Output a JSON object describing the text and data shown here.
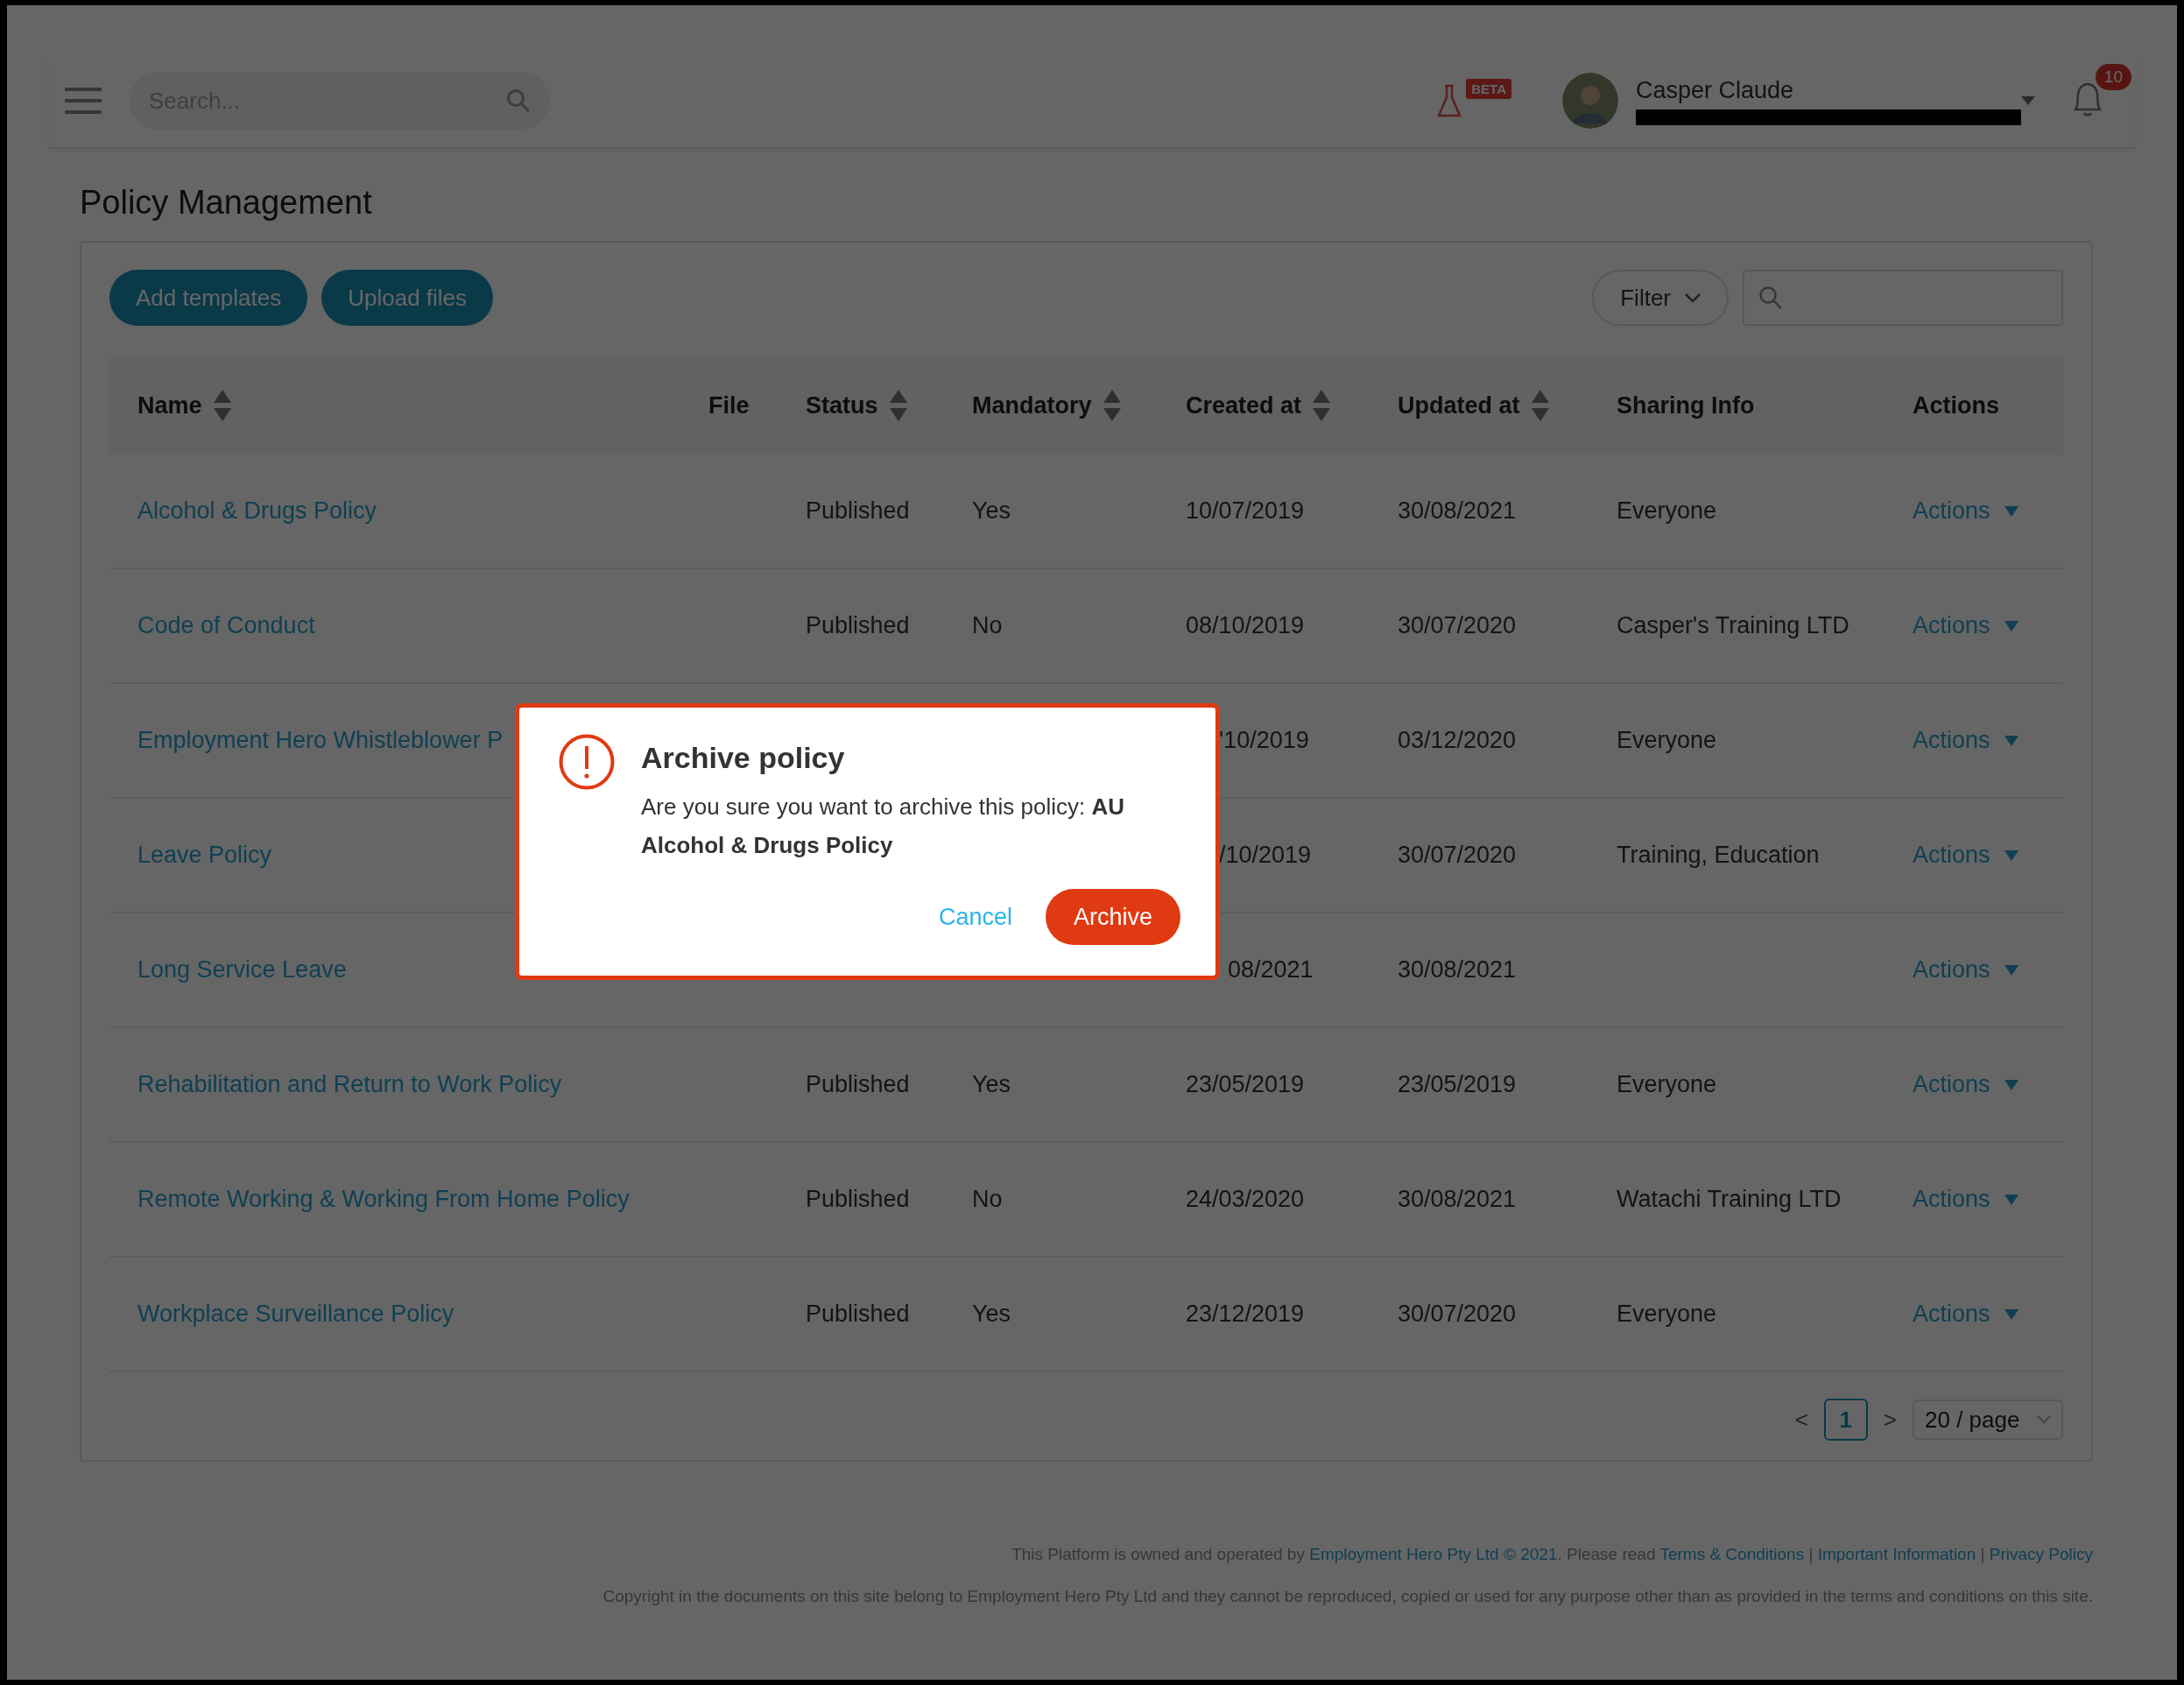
{
  "header": {
    "search": {
      "placeholder": "Search..."
    },
    "beta_badge": "BETA",
    "user": {
      "name": "Casper Claude"
    },
    "notifications": {
      "count": "10"
    }
  },
  "page_title": "Policy Management",
  "toolbar": {
    "buttons": [
      "Add templates",
      "Upload files"
    ],
    "filter": "Filter"
  },
  "table": {
    "columns": [
      {
        "label": "Name",
        "sortable": true
      },
      {
        "label": "File",
        "sortable": false
      },
      {
        "label": "Status",
        "sortable": true
      },
      {
        "label": "Mandatory",
        "sortable": true
      },
      {
        "label": "Created at",
        "sortable": true
      },
      {
        "label": "Updated at",
        "sortable": true
      },
      {
        "label": "Sharing Info",
        "sortable": false
      },
      {
        "label": "Actions",
        "sortable": false
      }
    ],
    "rows": [
      {
        "name": "Alcohol & Drugs Policy",
        "status": "Published",
        "mandatory": "Yes",
        "created": "10/07/2019",
        "updated": "30/08/2021",
        "sharing": "Everyone",
        "actions": "Actions"
      },
      {
        "name": "Code of Conduct",
        "status": "Published",
        "mandatory": "No",
        "created": "08/10/2019",
        "updated": "30/07/2020",
        "sharing": "Casper's Training LTD",
        "actions": "Actions"
      },
      {
        "name": "Employment Hero Whistleblower P",
        "created": "'10/2019",
        "updated": "03/12/2020",
        "sharing": "Everyone",
        "actions": "Actions"
      },
      {
        "name": "Leave Policy",
        "created": "/10/2019",
        "updated": "30/07/2020",
        "sharing": "Training, Education",
        "actions": "Actions"
      },
      {
        "name": "Long Service Leave",
        "created": "08/2021",
        "updated": "30/08/2021",
        "actions": "Actions"
      },
      {
        "name": "Rehabilitation and Return to Work Policy",
        "status": "Published",
        "mandatory": "Yes",
        "created": "23/05/2019",
        "updated": "23/05/2019",
        "sharing": "Everyone",
        "actions": "Actions"
      },
      {
        "name": "Remote Working & Working From Home Policy",
        "status": "Published",
        "mandatory": "No",
        "created": "24/03/2020",
        "updated": "30/08/2021",
        "sharing": "Watachi Training LTD",
        "actions": "Actions"
      },
      {
        "name": "Workplace Surveillance Policy",
        "status": "Published",
        "mandatory": "Yes",
        "created": "23/12/2019",
        "updated": "30/07/2020",
        "sharing": "Everyone",
        "actions": "Actions"
      }
    ]
  },
  "pagination": {
    "prev": "<",
    "pages": [
      {
        "label": "1",
        "selected": true
      }
    ],
    "next": ">",
    "page_size": "20 / page"
  },
  "footer": {
    "notice": [
      {
        "kind": "text",
        "text": "This Platform is owned and operated by "
      },
      {
        "kind": "link",
        "text": "Employment Hero Pty Ltd © 2021"
      },
      {
        "kind": "text",
        "text": ". Please read "
      },
      {
        "kind": "link",
        "text": "Terms & Conditions"
      },
      {
        "kind": "text",
        "text": " | "
      },
      {
        "kind": "link",
        "text": "Important Information"
      },
      {
        "kind": "text",
        "text": " | "
      },
      {
        "kind": "link",
        "text": "Privacy Policy"
      }
    ],
    "copyright": "Copyright in the documents on this site belong to Employment Hero Pty Ltd and they cannot be reproduced, copied or used for any purpose other than as provided in the terms and conditions on this site."
  },
  "dialog": {
    "title": "Archive policy",
    "message": "Are you sure you want to archive this policy: **AU Alcohol & Drugs Policy**",
    "cancel": "Cancel",
    "confirm": "Archive"
  }
}
